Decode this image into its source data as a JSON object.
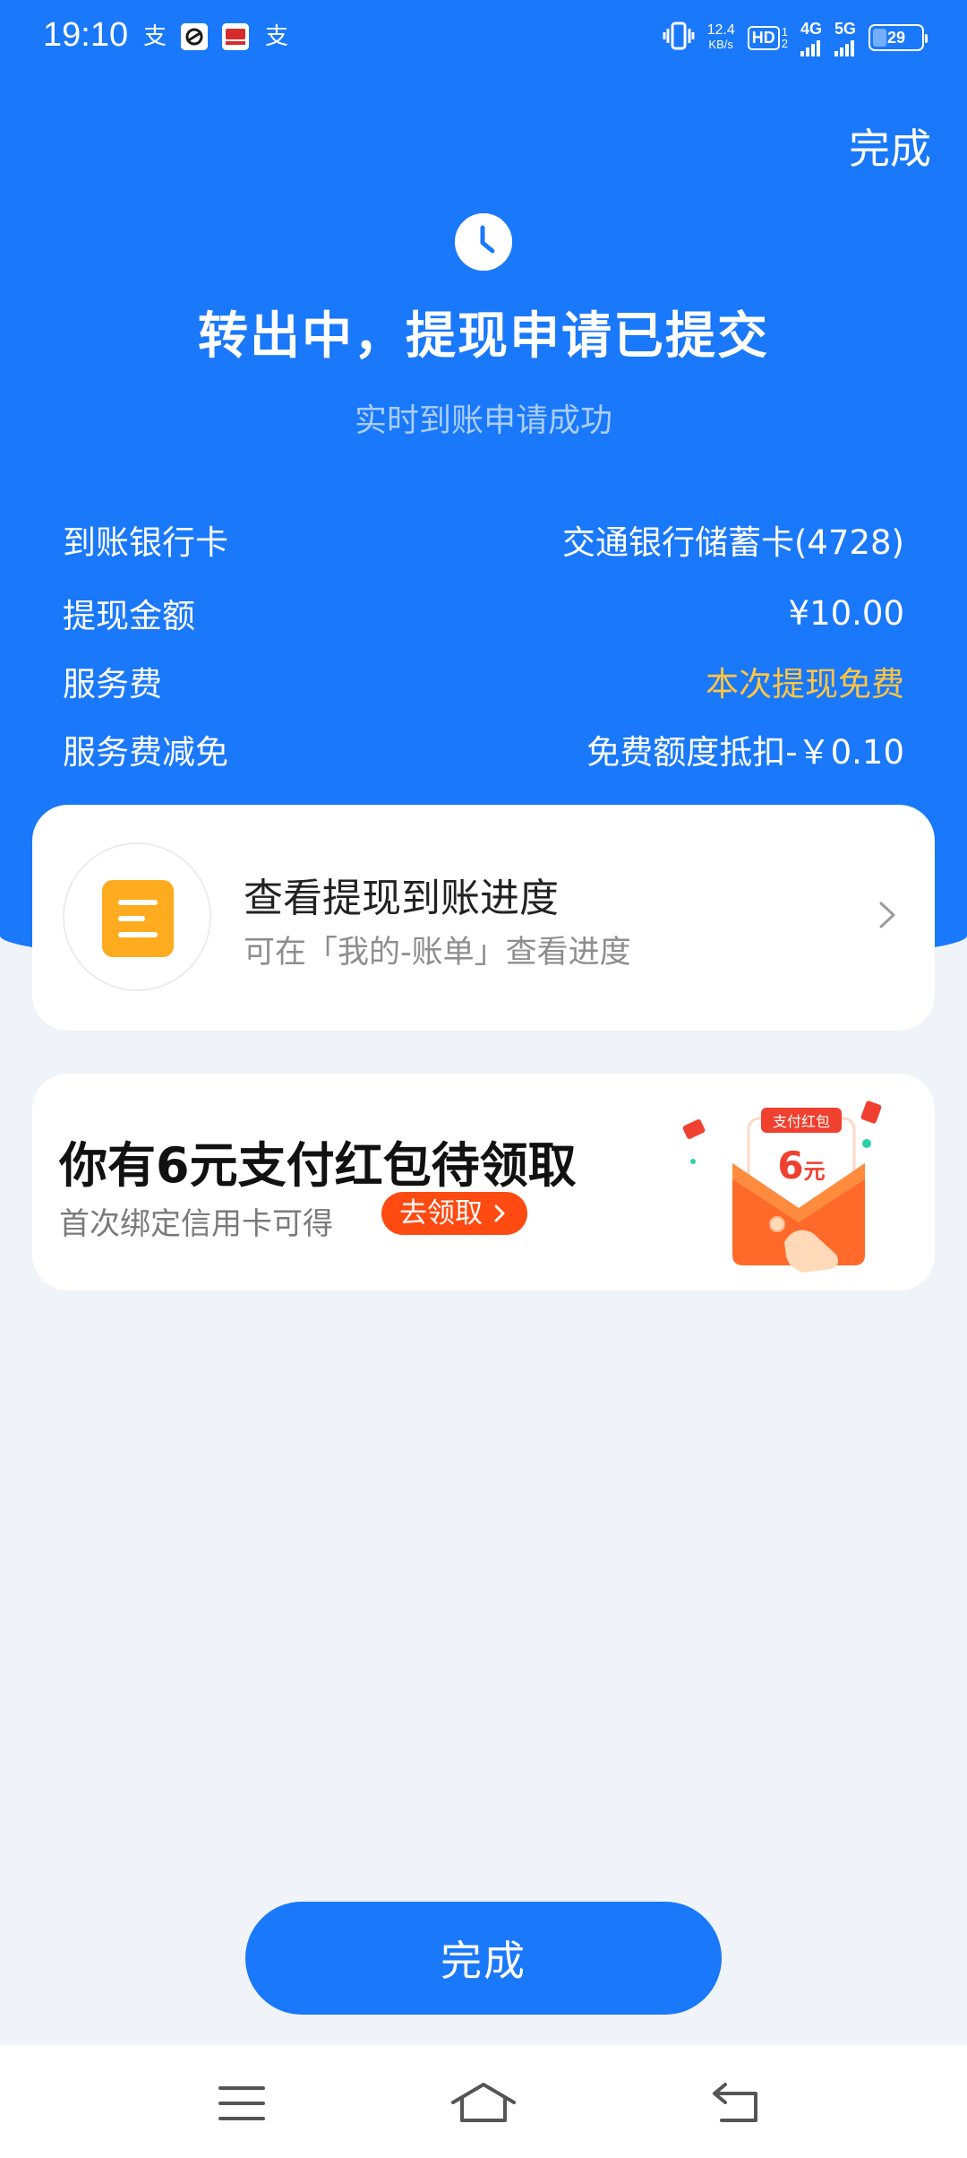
{
  "status_bar": {
    "time": "19:10",
    "app_icons": [
      "支",
      "支"
    ],
    "speed_value": "12.4",
    "speed_unit": "KB/s",
    "hd": "HD",
    "sim1_index": "1",
    "sim2_index": "2",
    "net1": "4G",
    "net2": "5G",
    "battery": "29",
    "battery_level": 0.29
  },
  "header": {
    "done_label": "完成",
    "title": "转出中，提现申请已提交",
    "subtitle": "实时到账申请成功"
  },
  "details": [
    {
      "label": "到账银行卡",
      "value": "交通银行储蓄卡(4728)"
    },
    {
      "label": "提现金额",
      "value": "¥10.00"
    },
    {
      "label": "服务费",
      "value": "本次提现免费"
    },
    {
      "label": "服务费减免",
      "value": "免费额度抵扣-￥0.10"
    }
  ],
  "progress_card": {
    "title": "查看提现到账进度",
    "subtitle": "可在「我的-账单」查看进度"
  },
  "promo_card": {
    "title": "你有6元支付红包待领取",
    "subtitle": "首次绑定信用卡可得",
    "button": "去领取",
    "envelope_label": "支付红包",
    "envelope_amount": "6",
    "envelope_unit": "元"
  },
  "footer": {
    "done_label": "完成"
  },
  "colors": {
    "primary": "#1a78fa",
    "fee_free": "#ffc542",
    "promo_button": "#ff4a11",
    "doc_icon": "#ffab1f",
    "page_bg": "#f0f3f8"
  },
  "icons": {
    "status": [
      "alipay-icon",
      "wallet-app-icon",
      "bank-app-icon",
      "alipay-icon",
      "vibrate-icon",
      "signal-icon",
      "battery-icon"
    ],
    "header": "clock-icon",
    "progress": "bill-document-icon",
    "progress_arrow": "chevron-right-icon",
    "promo": "red-envelope-icon",
    "nav": [
      "menu-icon",
      "home-icon",
      "back-icon"
    ]
  }
}
